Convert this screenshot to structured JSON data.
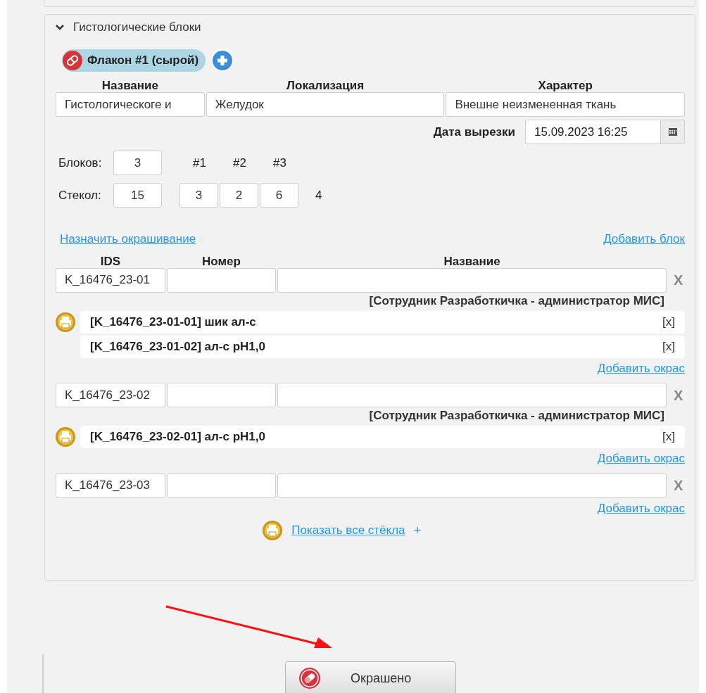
{
  "section": {
    "title": "Гистологические блоки",
    "expanded": true
  },
  "vials": [
    {
      "label": "Флакон #1 (сырой)",
      "selected": true
    }
  ],
  "vial_fields": {
    "columns": [
      "Название",
      "Локализация",
      "Характер"
    ],
    "values": [
      "Гистологическоге и",
      "Желудок",
      "Внешне неизмененная ткань"
    ]
  },
  "cut_date": {
    "label": "Дата вырезки",
    "value": "15.09.2023 16:25"
  },
  "counts": {
    "blocks_label": "Блоков:",
    "blocks": "3",
    "slides_label": "Стекол:",
    "slides": "15",
    "block_headers": [
      "#1",
      "#2",
      "#3"
    ],
    "block_slides": [
      "3",
      "2",
      "6"
    ],
    "extra": "4"
  },
  "links": {
    "assign": "Назначить окрашивание",
    "add_block": "Добавить блок"
  },
  "table": {
    "columns": [
      "IDS",
      "Номер",
      "Название"
    ],
    "rows": [
      {
        "ids": "K_16476_23-01",
        "remove": "X",
        "author": "[Сотрудник Разработкичка - администратор МИС]",
        "stains": [
          {
            "label": "[K_16476_23-01-01] шик ал-с",
            "remove": "[x]"
          },
          {
            "label": "[K_16476_23-01-02] ал-с pH1,0",
            "remove": "[x]"
          }
        ],
        "add_stain": "Добавить окрас"
      },
      {
        "ids": "K_16476_23-02",
        "remove": "X",
        "author": "[Сотрудник Разработкичка - администратор МИС]",
        "stains": [
          {
            "label": "[K_16476_23-02-01] ал-с pH1,0",
            "remove": "[x]"
          }
        ],
        "add_stain": "Добавить окрас"
      },
      {
        "ids": "K_16476_23-03",
        "remove": "X",
        "add_stain": "Добавить окрас"
      }
    ]
  },
  "show_all": {
    "label": "Показать все стёкла",
    "plus": "+"
  },
  "action_button": {
    "label": "Окрашено"
  }
}
